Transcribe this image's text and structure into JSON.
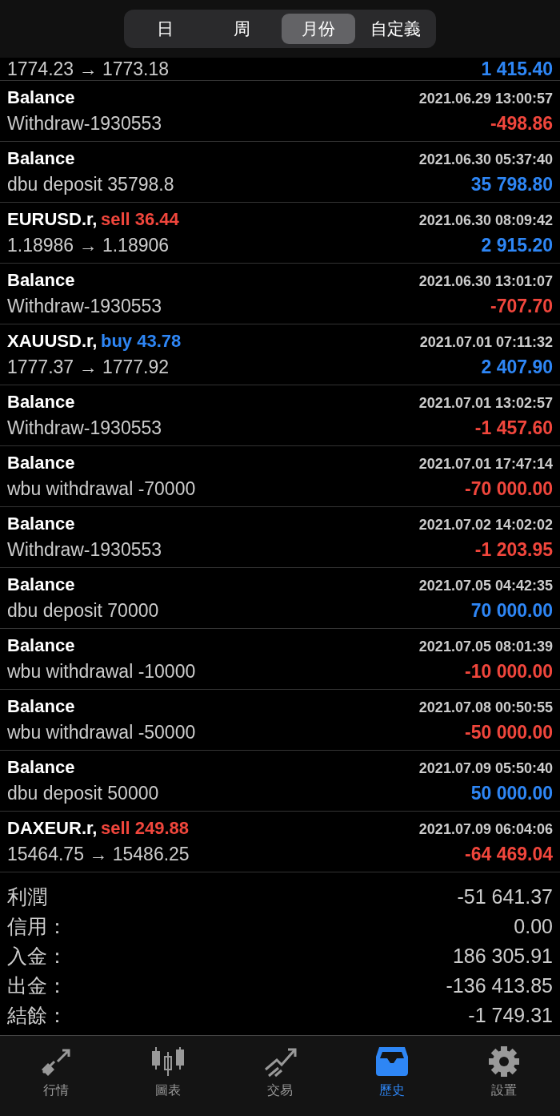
{
  "period_tabs": [
    {
      "label": "日",
      "selected": false
    },
    {
      "label": "周",
      "selected": false
    },
    {
      "label": "月份",
      "selected": true
    },
    {
      "label": "自定義",
      "selected": false
    }
  ],
  "partial_row": {
    "detail": "1774.23 → 1773.18",
    "amount": "1 415.40",
    "positive": true
  },
  "rows": [
    {
      "kind": "balance",
      "title": "Balance",
      "time": "2021.06.29 13:00:57",
      "detail": "Withdraw-1930553",
      "amount": "-498.86",
      "positive": false
    },
    {
      "kind": "balance",
      "title": "Balance",
      "time": "2021.06.30 05:37:40",
      "detail": "dbu deposit 35798.8",
      "amount": "35 798.80",
      "positive": true
    },
    {
      "kind": "trade",
      "symbol": "EURUSD.r,",
      "action": "sell 36.44",
      "color": "#f0463c",
      "time": "2021.06.30 08:09:42",
      "detail": "1.18986 → 1.18906",
      "amount": "2 915.20",
      "positive": true
    },
    {
      "kind": "balance",
      "title": "Balance",
      "time": "2021.06.30 13:01:07",
      "detail": "Withdraw-1930553",
      "amount": "-707.70",
      "positive": false
    },
    {
      "kind": "trade",
      "symbol": "XAUUSD.r,",
      "action": "buy 43.78",
      "color": "#2e86f5",
      "time": "2021.07.01 07:11:32",
      "detail": "1777.37 → 1777.92",
      "amount": "2 407.90",
      "positive": true
    },
    {
      "kind": "balance",
      "title": "Balance",
      "time": "2021.07.01 13:02:57",
      "detail": "Withdraw-1930553",
      "amount": "-1 457.60",
      "positive": false
    },
    {
      "kind": "balance",
      "title": "Balance",
      "time": "2021.07.01 17:47:14",
      "detail": "wbu withdrawal -70000",
      "amount": "-70 000.00",
      "positive": false
    },
    {
      "kind": "balance",
      "title": "Balance",
      "time": "2021.07.02 14:02:02",
      "detail": "Withdraw-1930553",
      "amount": "-1 203.95",
      "positive": false
    },
    {
      "kind": "balance",
      "title": "Balance",
      "time": "2021.07.05 04:42:35",
      "detail": "dbu deposit 70000",
      "amount": "70 000.00",
      "positive": true
    },
    {
      "kind": "balance",
      "title": "Balance",
      "time": "2021.07.05 08:01:39",
      "detail": "wbu withdrawal -10000",
      "amount": "-10 000.00",
      "positive": false
    },
    {
      "kind": "balance",
      "title": "Balance",
      "time": "2021.07.08 00:50:55",
      "detail": "wbu withdrawal -50000",
      "amount": "-50 000.00",
      "positive": false
    },
    {
      "kind": "balance",
      "title": "Balance",
      "time": "2021.07.09 05:50:40",
      "detail": "dbu deposit 50000",
      "amount": "50 000.00",
      "positive": true
    },
    {
      "kind": "trade",
      "symbol": "DAXEUR.r,",
      "action": "sell 249.88",
      "color": "#f0463c",
      "time": "2021.07.09 06:04:06",
      "detail": "15464.75 → 15486.25",
      "amount": "-64 469.04",
      "positive": false
    }
  ],
  "summary": [
    {
      "label": "利潤",
      "value": "-51 641.37"
    },
    {
      "label": "信用：",
      "value": "0.00"
    },
    {
      "label": "入金：",
      "value": "186 305.91"
    },
    {
      "label": "出金：",
      "value": "-136 413.85"
    },
    {
      "label": "結餘：",
      "value": "-1 749.31"
    }
  ],
  "tab_bar": [
    {
      "label": "行情",
      "kind": "quotes",
      "selected": false
    },
    {
      "label": "圖表",
      "kind": "chart",
      "selected": false
    },
    {
      "label": "交易",
      "kind": "trade",
      "selected": false
    },
    {
      "label": "歷史",
      "kind": "history",
      "selected": true
    },
    {
      "label": "設置",
      "kind": "settings",
      "selected": false
    }
  ]
}
